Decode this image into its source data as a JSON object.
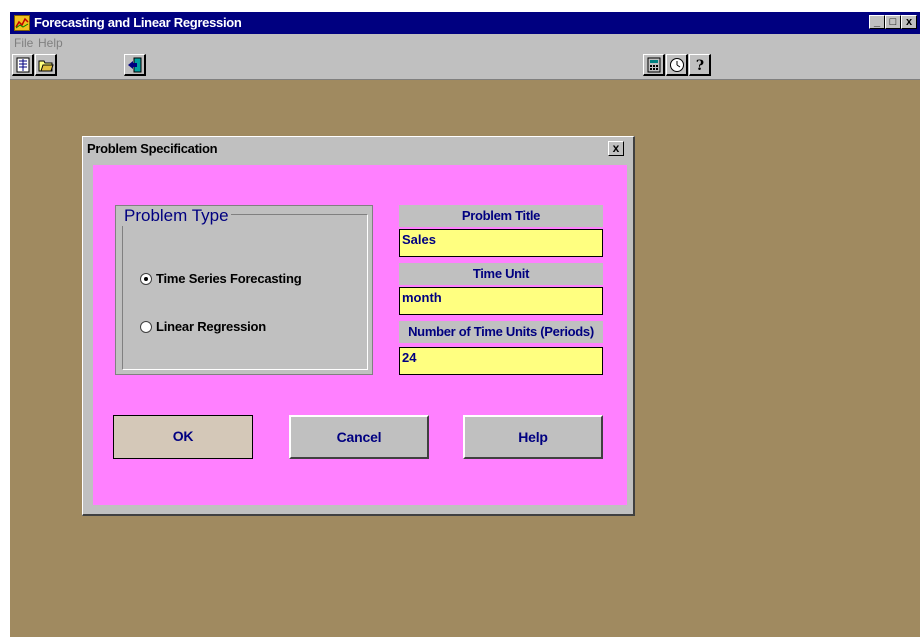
{
  "window": {
    "title": "Forecasting and Linear Regression",
    "controls": {
      "minimize": "_",
      "maximize": "□",
      "close": "x"
    }
  },
  "menu": {
    "items": [
      {
        "label": "File"
      },
      {
        "label": "Help"
      }
    ]
  },
  "toolbar": {
    "icons": [
      "new-document-icon",
      "open-folder-icon",
      "exit-door-icon",
      "calculator-icon",
      "clock-icon",
      "help-question-icon"
    ]
  },
  "dialog": {
    "title": "Problem Specification",
    "close": "x",
    "problem_type": {
      "legend": "Problem Type",
      "options": [
        {
          "label": "Time Series Forecasting",
          "selected": true
        },
        {
          "label": "Linear Regression",
          "selected": false
        }
      ]
    },
    "fields": {
      "problem_title": {
        "label": "Problem Title",
        "value": "Sales"
      },
      "time_unit": {
        "label": "Time Unit",
        "value": "month"
      },
      "periods": {
        "label": "Number of Time Units (Periods)",
        "value": "24"
      }
    },
    "buttons": {
      "ok": "OK",
      "cancel": "Cancel",
      "help": "Help"
    }
  },
  "colors": {
    "title_bar": "#000080",
    "workspace": "#a08a60",
    "dialog_body": "#ff80ff",
    "input_bg": "#ffff80",
    "label_text": "#000080"
  }
}
